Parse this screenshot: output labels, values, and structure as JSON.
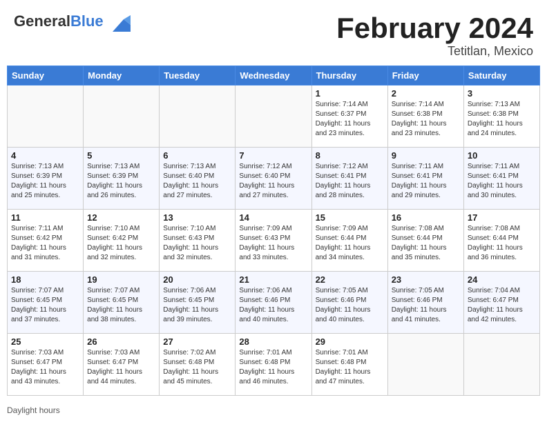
{
  "header": {
    "logo": {
      "general": "General",
      "blue": "Blue"
    },
    "month_year": "February 2024",
    "location": "Tetitlan, Mexico"
  },
  "days": [
    "Sunday",
    "Monday",
    "Tuesday",
    "Wednesday",
    "Thursday",
    "Friday",
    "Saturday"
  ],
  "footer": {
    "daylight_label": "Daylight hours"
  },
  "weeks": [
    [
      {
        "date": "",
        "info": ""
      },
      {
        "date": "",
        "info": ""
      },
      {
        "date": "",
        "info": ""
      },
      {
        "date": "",
        "info": ""
      },
      {
        "date": "1",
        "info": "Sunrise: 7:14 AM\nSunset: 6:37 PM\nDaylight: 11 hours and 23 minutes."
      },
      {
        "date": "2",
        "info": "Sunrise: 7:14 AM\nSunset: 6:38 PM\nDaylight: 11 hours and 23 minutes."
      },
      {
        "date": "3",
        "info": "Sunrise: 7:13 AM\nSunset: 6:38 PM\nDaylight: 11 hours and 24 minutes."
      }
    ],
    [
      {
        "date": "4",
        "info": "Sunrise: 7:13 AM\nSunset: 6:39 PM\nDaylight: 11 hours and 25 minutes."
      },
      {
        "date": "5",
        "info": "Sunrise: 7:13 AM\nSunset: 6:39 PM\nDaylight: 11 hours and 26 minutes."
      },
      {
        "date": "6",
        "info": "Sunrise: 7:13 AM\nSunset: 6:40 PM\nDaylight: 11 hours and 27 minutes."
      },
      {
        "date": "7",
        "info": "Sunrise: 7:12 AM\nSunset: 6:40 PM\nDaylight: 11 hours and 27 minutes."
      },
      {
        "date": "8",
        "info": "Sunrise: 7:12 AM\nSunset: 6:41 PM\nDaylight: 11 hours and 28 minutes."
      },
      {
        "date": "9",
        "info": "Sunrise: 7:11 AM\nSunset: 6:41 PM\nDaylight: 11 hours and 29 minutes."
      },
      {
        "date": "10",
        "info": "Sunrise: 7:11 AM\nSunset: 6:41 PM\nDaylight: 11 hours and 30 minutes."
      }
    ],
    [
      {
        "date": "11",
        "info": "Sunrise: 7:11 AM\nSunset: 6:42 PM\nDaylight: 11 hours and 31 minutes."
      },
      {
        "date": "12",
        "info": "Sunrise: 7:10 AM\nSunset: 6:42 PM\nDaylight: 11 hours and 32 minutes."
      },
      {
        "date": "13",
        "info": "Sunrise: 7:10 AM\nSunset: 6:43 PM\nDaylight: 11 hours and 32 minutes."
      },
      {
        "date": "14",
        "info": "Sunrise: 7:09 AM\nSunset: 6:43 PM\nDaylight: 11 hours and 33 minutes."
      },
      {
        "date": "15",
        "info": "Sunrise: 7:09 AM\nSunset: 6:44 PM\nDaylight: 11 hours and 34 minutes."
      },
      {
        "date": "16",
        "info": "Sunrise: 7:08 AM\nSunset: 6:44 PM\nDaylight: 11 hours and 35 minutes."
      },
      {
        "date": "17",
        "info": "Sunrise: 7:08 AM\nSunset: 6:44 PM\nDaylight: 11 hours and 36 minutes."
      }
    ],
    [
      {
        "date": "18",
        "info": "Sunrise: 7:07 AM\nSunset: 6:45 PM\nDaylight: 11 hours and 37 minutes."
      },
      {
        "date": "19",
        "info": "Sunrise: 7:07 AM\nSunset: 6:45 PM\nDaylight: 11 hours and 38 minutes."
      },
      {
        "date": "20",
        "info": "Sunrise: 7:06 AM\nSunset: 6:45 PM\nDaylight: 11 hours and 39 minutes."
      },
      {
        "date": "21",
        "info": "Sunrise: 7:06 AM\nSunset: 6:46 PM\nDaylight: 11 hours and 40 minutes."
      },
      {
        "date": "22",
        "info": "Sunrise: 7:05 AM\nSunset: 6:46 PM\nDaylight: 11 hours and 40 minutes."
      },
      {
        "date": "23",
        "info": "Sunrise: 7:05 AM\nSunset: 6:46 PM\nDaylight: 11 hours and 41 minutes."
      },
      {
        "date": "24",
        "info": "Sunrise: 7:04 AM\nSunset: 6:47 PM\nDaylight: 11 hours and 42 minutes."
      }
    ],
    [
      {
        "date": "25",
        "info": "Sunrise: 7:03 AM\nSunset: 6:47 PM\nDaylight: 11 hours and 43 minutes."
      },
      {
        "date": "26",
        "info": "Sunrise: 7:03 AM\nSunset: 6:47 PM\nDaylight: 11 hours and 44 minutes."
      },
      {
        "date": "27",
        "info": "Sunrise: 7:02 AM\nSunset: 6:48 PM\nDaylight: 11 hours and 45 minutes."
      },
      {
        "date": "28",
        "info": "Sunrise: 7:01 AM\nSunset: 6:48 PM\nDaylight: 11 hours and 46 minutes."
      },
      {
        "date": "29",
        "info": "Sunrise: 7:01 AM\nSunset: 6:48 PM\nDaylight: 11 hours and 47 minutes."
      },
      {
        "date": "",
        "info": ""
      },
      {
        "date": "",
        "info": ""
      }
    ]
  ]
}
